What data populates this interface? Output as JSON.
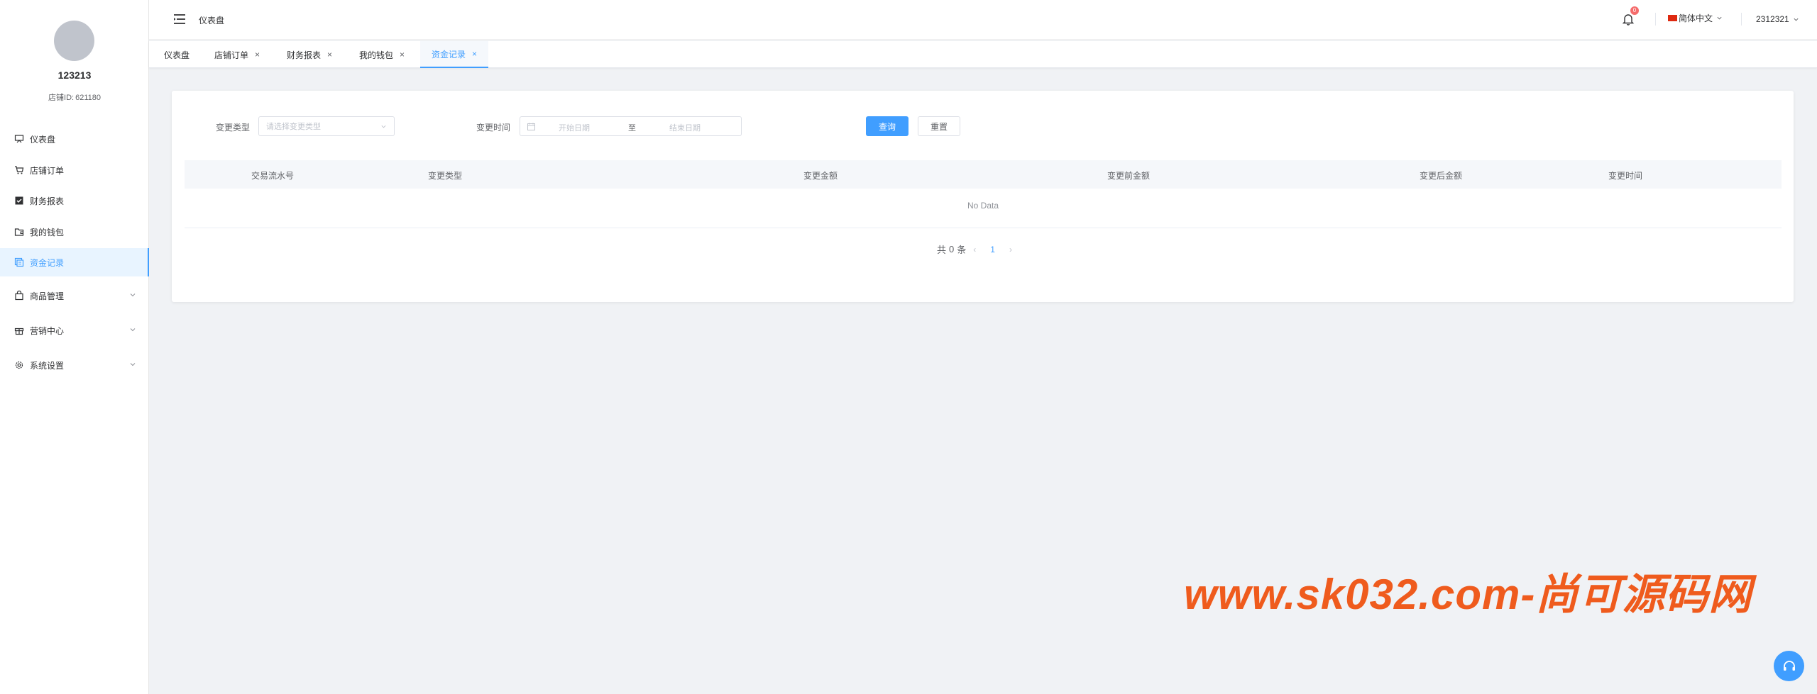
{
  "sidebar": {
    "username": "123213",
    "shop_id_label": "店铺ID:",
    "shop_id_value": "621180",
    "items": [
      {
        "label": "仪表盘",
        "icon": "dashboard-icon"
      },
      {
        "label": "店铺订单",
        "icon": "cart-icon"
      },
      {
        "label": "财务报表",
        "icon": "checkbox-icon"
      },
      {
        "label": "我的钱包",
        "icon": "wallet-icon"
      },
      {
        "label": "资金记录",
        "icon": "record-icon",
        "active": true
      },
      {
        "label": "商品管理",
        "icon": "bag-icon",
        "expandable": true
      },
      {
        "label": "营销中心",
        "icon": "gift-icon",
        "expandable": true
      },
      {
        "label": "系统设置",
        "icon": "gear-icon",
        "expandable": true
      }
    ]
  },
  "header": {
    "breadcrumb": "仪表盘",
    "notification_count": "0",
    "language": "简体中文",
    "user": "2312321"
  },
  "tabs": [
    {
      "label": "仪表盘",
      "closable": false
    },
    {
      "label": "店铺订单",
      "closable": true
    },
    {
      "label": "财务报表",
      "closable": true
    },
    {
      "label": "我的钱包",
      "closable": true
    },
    {
      "label": "资金记录",
      "closable": true,
      "active": true
    }
  ],
  "close_glyph": "×",
  "filters": {
    "type_label": "变更类型",
    "type_placeholder": "请选择变更类型",
    "time_label": "变更时间",
    "start_placeholder": "开始日期",
    "range_separator": "至",
    "end_placeholder": "结束日期",
    "search_button": "查询",
    "reset_button": "重置"
  },
  "table": {
    "columns": [
      "交易流水号",
      "变更类型",
      "变更金额",
      "变更前金额",
      "变更后金额",
      "变更时间"
    ],
    "rows": [],
    "empty_text": "No Data"
  },
  "pagination": {
    "total_prefix": "共",
    "total": "0",
    "total_suffix": "条",
    "prev": "‹",
    "current_page": "1",
    "next": "›"
  },
  "watermark": "www.sk032.com-尚可源码网",
  "colors": {
    "primary": "#409eff",
    "active_bg": "#e8f4ff",
    "badge": "#f56c6c",
    "watermark": "#ef5b1d"
  }
}
